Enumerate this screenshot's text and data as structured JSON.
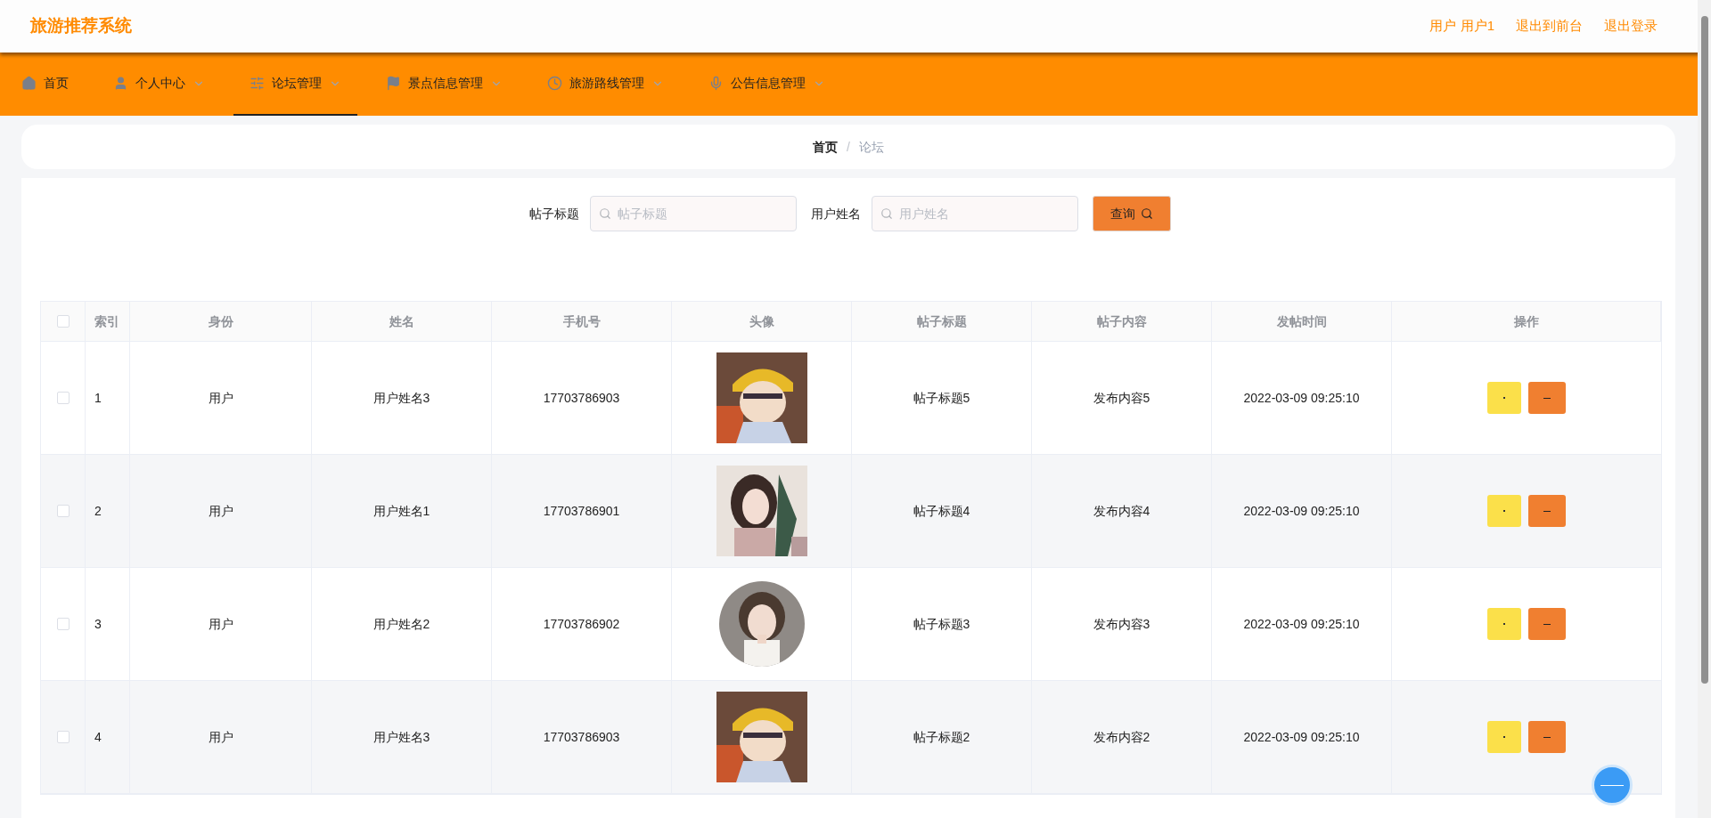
{
  "header": {
    "title": "旅游推荐系统",
    "links": [
      "用户 用户1",
      "退出到前台",
      "退出登录"
    ]
  },
  "nav": [
    {
      "label": "首页",
      "selected": false,
      "dropdown": false
    },
    {
      "label": "个人中心",
      "selected": false,
      "dropdown": true
    },
    {
      "label": "论坛管理",
      "selected": true,
      "dropdown": true
    },
    {
      "label": "景点信息管理",
      "selected": false,
      "dropdown": true
    },
    {
      "label": "旅游路线管理",
      "selected": false,
      "dropdown": true
    },
    {
      "label": "公告信息管理",
      "selected": false,
      "dropdown": true
    }
  ],
  "breadcrumb": {
    "items": [
      "首页",
      "论坛"
    ],
    "separator": "/"
  },
  "search": {
    "fields": [
      {
        "label": "帖子标题",
        "placeholder": "帖子标题"
      },
      {
        "label": "用户姓名",
        "placeholder": "用户姓名"
      }
    ],
    "button": "查询"
  },
  "table": {
    "select_all_checked": false,
    "columns": [
      "索引",
      "身份",
      "姓名",
      "手机号",
      "头像",
      "帖子标题",
      "帖子内容",
      "发帖时间",
      "操作"
    ],
    "rows": [
      {
        "checked": false,
        "index": "1",
        "role": "用户",
        "name": "用户姓名3",
        "phone": "17703786903",
        "title": "帖子标题5",
        "content": "发布内容5",
        "time": "2022-03-09 09:25:10"
      },
      {
        "checked": false,
        "index": "2",
        "role": "用户",
        "name": "用户姓名1",
        "phone": "17703786901",
        "title": "帖子标题4",
        "content": "发布内容4",
        "time": "2022-03-09 09:25:10"
      },
      {
        "checked": false,
        "index": "3",
        "role": "用户",
        "name": "用户姓名2",
        "phone": "17703786902",
        "title": "帖子标题3",
        "content": "发布内容3",
        "time": "2022-03-09 09:25:10"
      },
      {
        "checked": false,
        "index": "4",
        "role": "用户",
        "name": "用户姓名3",
        "phone": "17703786903",
        "title": "帖子标题2",
        "content": "发布内容2",
        "time": "2022-03-09 09:25:10"
      }
    ]
  }
}
